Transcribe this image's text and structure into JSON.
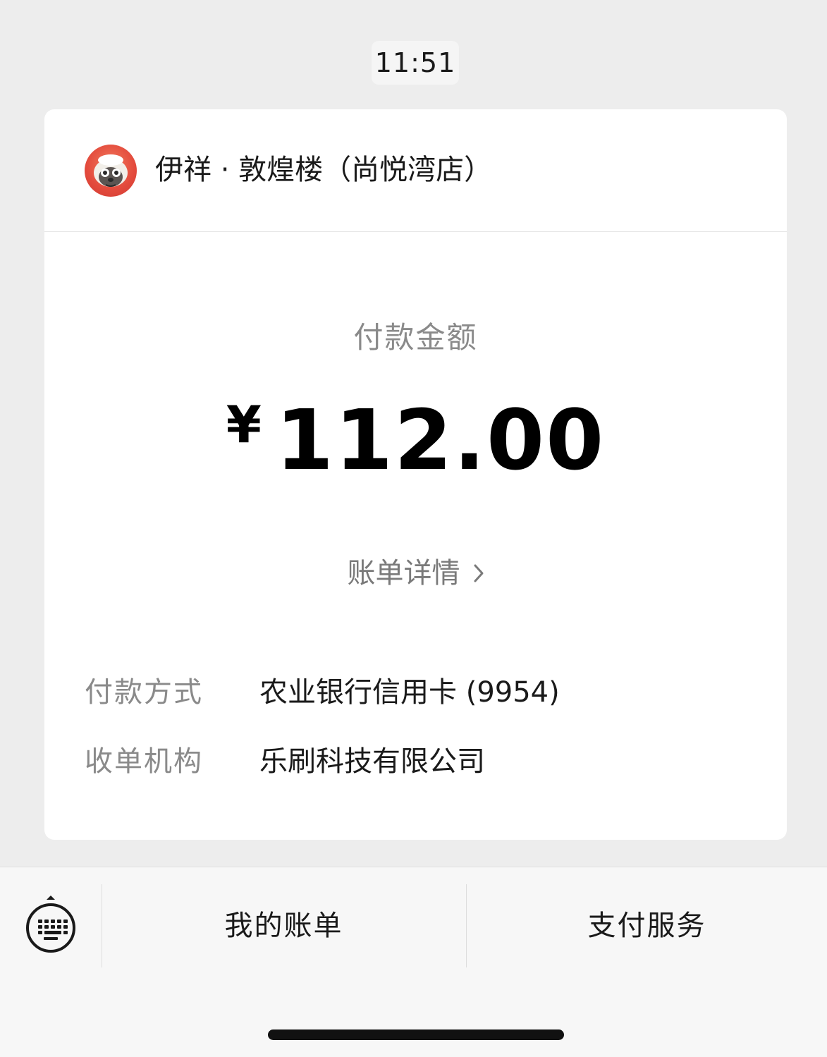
{
  "message_time": "11:51",
  "merchant": {
    "name": "伊祥 · 敦煌楼（尚悦湾店）",
    "avatar_icon": "merchant-avatar-icon"
  },
  "payment": {
    "label": "付款金额",
    "currency": "¥",
    "amount": "112.00",
    "bill_details_label": "账单详情",
    "bill_details_icon": "chevron-right-icon"
  },
  "details": [
    {
      "key": "付款方式",
      "value": "农业银行信用卡 (9954)"
    },
    {
      "key": "收单机构",
      "value": "乐刷科技有限公司"
    }
  ],
  "bottom_menu": {
    "keyboard_icon": "keyboard-icon",
    "items": [
      {
        "label": "我的账单"
      },
      {
        "label": "支付服务"
      }
    ]
  },
  "colors": {
    "background": "#ededed",
    "card": "#ffffff",
    "muted_text": "#8a8a8a",
    "primary_text": "#1a1a1a",
    "avatar_red": "#e34a3c"
  }
}
